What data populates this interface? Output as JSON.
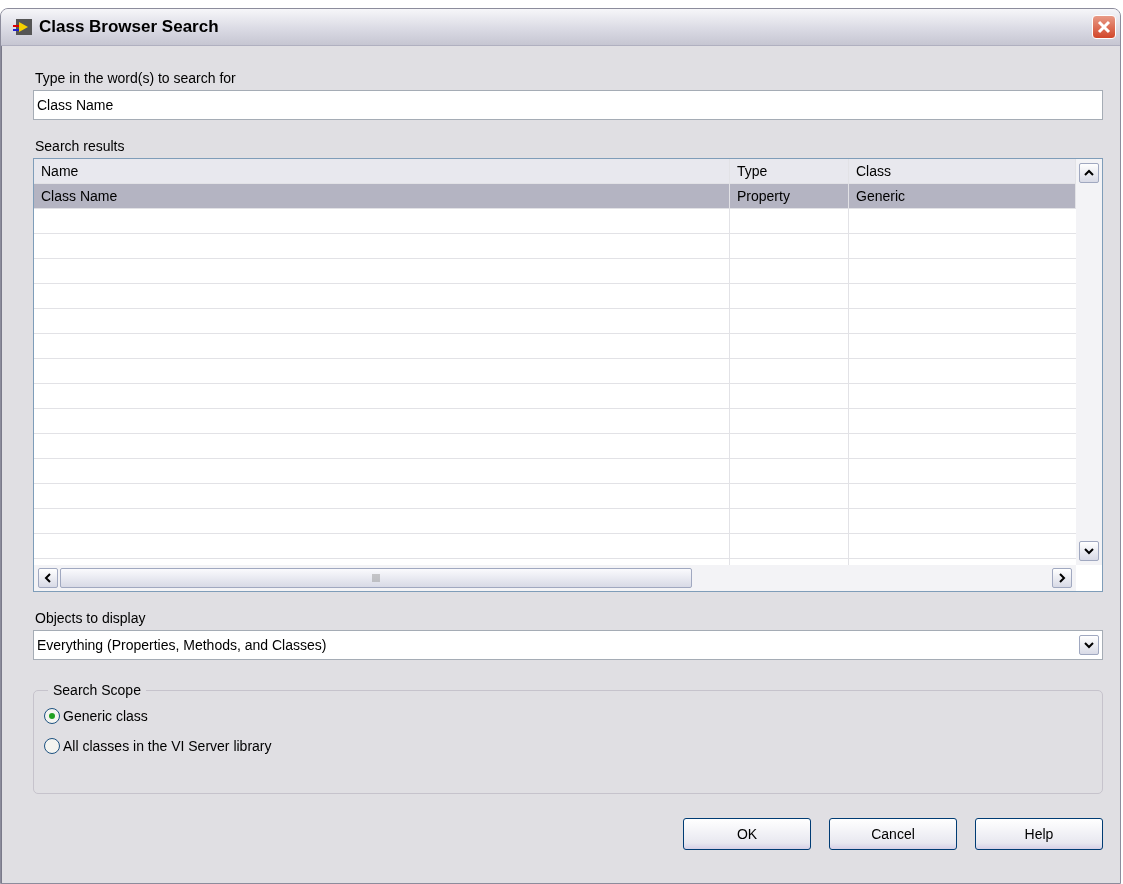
{
  "window": {
    "title": "Class Browser Search"
  },
  "search": {
    "label": "Type in the word(s) to search for",
    "value": "Class Name"
  },
  "results": {
    "label": "Search results",
    "columns": [
      "Name",
      "Type",
      "Class"
    ],
    "rows": [
      {
        "cells": [
          "Class Name",
          "Property",
          "Generic"
        ],
        "selected": true
      }
    ]
  },
  "objects": {
    "label": "Objects to display",
    "value": "Everything (Properties, Methods, and Classes)"
  },
  "scope": {
    "title": "Search Scope",
    "options": [
      {
        "label": "Generic class",
        "selected": true
      },
      {
        "label": "All classes in the VI Server library",
        "selected": false
      }
    ]
  },
  "buttons": [
    {
      "label": "OK"
    },
    {
      "label": "Cancel"
    },
    {
      "label": "Help"
    }
  ]
}
